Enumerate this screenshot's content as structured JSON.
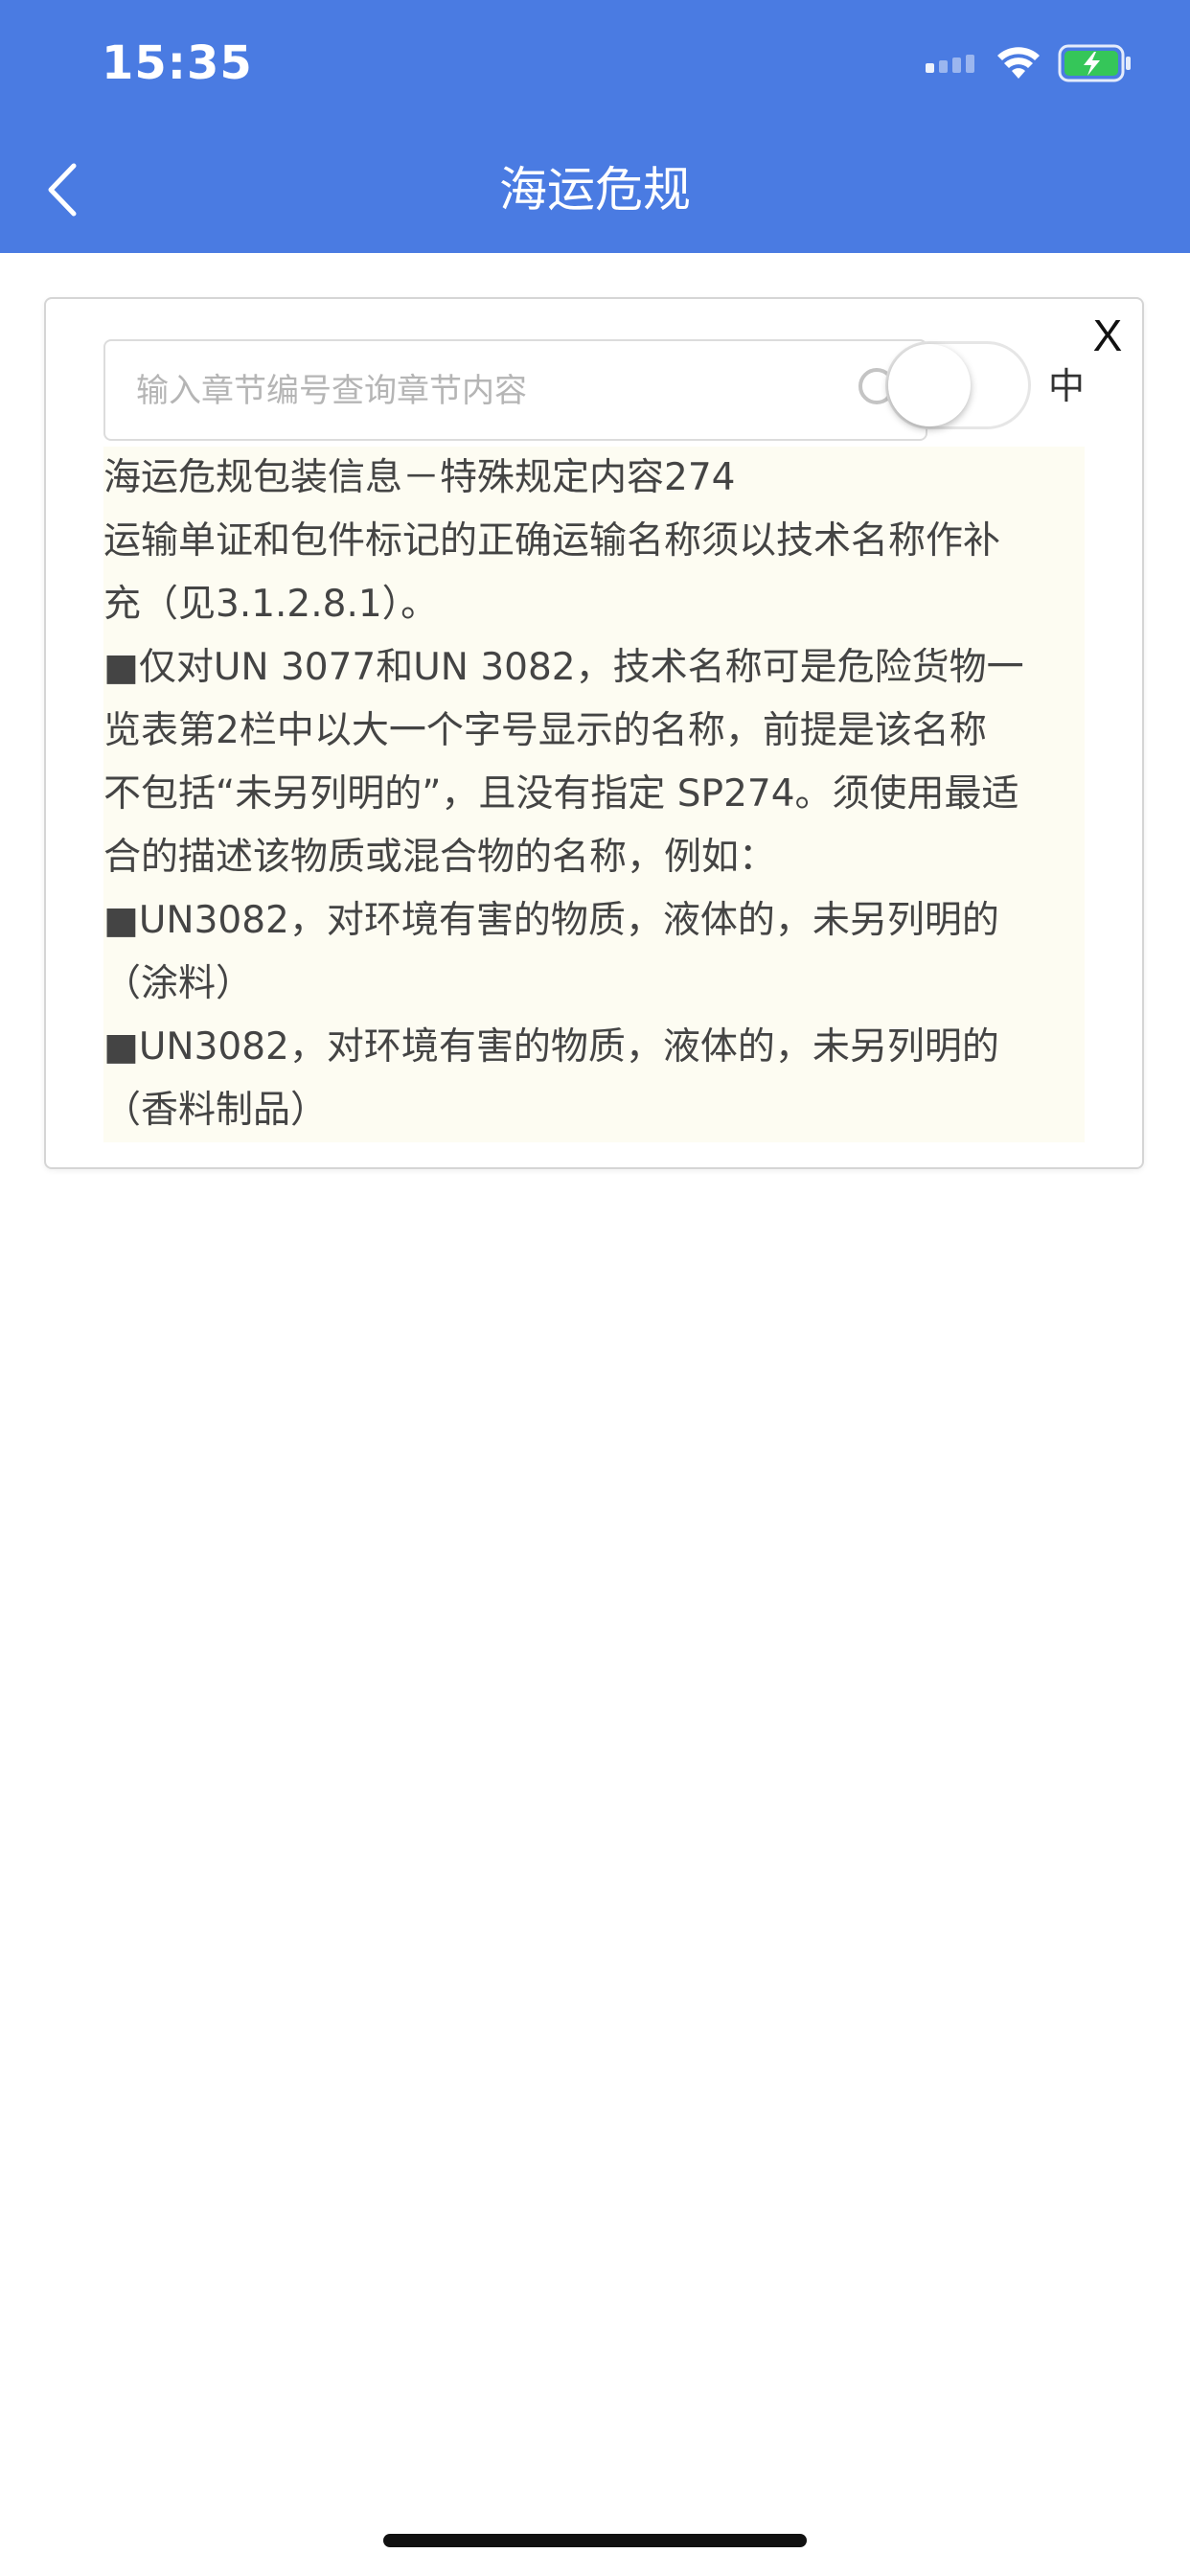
{
  "status_bar": {
    "time": "15:35",
    "icons": [
      "signal-icon",
      "wifi-icon",
      "battery-charging-icon"
    ],
    "battery_color": "#35c659"
  },
  "header": {
    "title": "海运危规",
    "background": "#4a7be2",
    "back_icon": "chevron-left-icon"
  },
  "card": {
    "close_label": "X",
    "search": {
      "placeholder": "输入章节编号查询章节内容",
      "value": "",
      "icon": "search-icon"
    },
    "toggle": {
      "on": false,
      "label": "中"
    },
    "content_lines": [
      "海运危规包装信息－特殊规定内容274",
      "运输单证和包件标记的正确运输名称须以技术名称作补",
      "充（见3.1.2.8.1）。",
      "■仅对UN 3077和UN 3082，技术名称可是危险货物一",
      "览表第2栏中以大一个字号显示的名称，前提是该名称",
      "不包括“未另列明的”，且没有指定 SP274。须使用最适",
      "合的描述该物质或混合物的名称，例如：",
      "■UN3082，对环境有害的物质，液体的，未另列明的",
      "（涂料）",
      "■UN3082，对环境有害的物质，液体的，未另列明的",
      "（香料制品）"
    ],
    "content_background": "#fdfcf2"
  }
}
